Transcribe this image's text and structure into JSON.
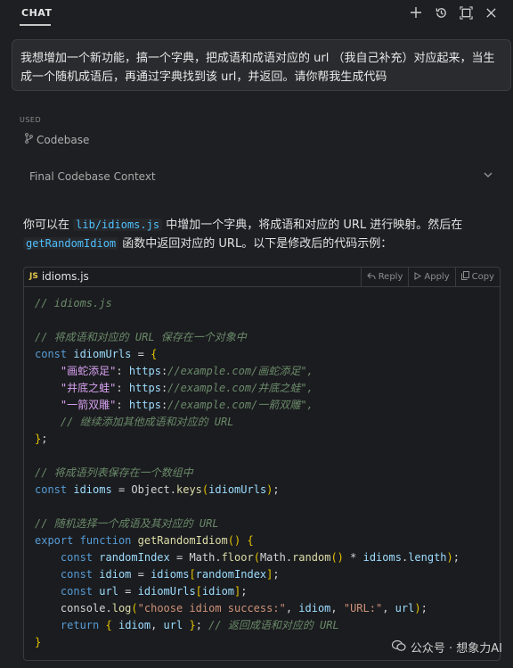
{
  "header": {
    "tab_label": "CHAT"
  },
  "header_icons": [
    "plus-icon",
    "history-icon",
    "maximize-icon",
    "close-icon"
  ],
  "user_message": "我想增加一个新功能，搞一个字典，把成语和成语对应的 url （我自己补充）对应起来，当生成一个随机成语后，再通过字典找到该 url，并返回。请你帮我生成代码",
  "context": {
    "used_label": "USED",
    "codebase_label": "Codebase",
    "final_label": "Final Codebase Context"
  },
  "answer": {
    "part1": "你可以在 ",
    "code1": "lib/idioms.js",
    "part2": " 中增加一个字典，将成语和对应的 URL 进行映射。然后在 ",
    "code2": "getRandomIdiom",
    "part3": " 函数中返回对应的 URL。以下是修改后的代码示例："
  },
  "code_block": {
    "filename": "idioms.js",
    "lang_badge": "JS",
    "actions": {
      "reply": "Reply",
      "apply": "Apply",
      "copy": "Copy"
    },
    "lines": [
      "// idioms.js",
      "",
      "// 将成语和对应的 URL 保存在一个对象中",
      "const idiomUrls = {",
      "    \"画蛇添足\": \"https://example.com/画蛇添足\",",
      "    \"井底之蛙\": \"https://example.com/井底之蛙\",",
      "    \"一箭双雕\": \"https://example.com/一箭双雕\",",
      "    // 继续添加其他成语和对应的 URL",
      "};",
      "",
      "// 将成语列表保存在一个数组中",
      "const idioms = Object.keys(idiomUrls);",
      "",
      "// 随机选择一个成语及其对应的 URL",
      "export function getRandomIdiom() {",
      "    const randomIndex = Math.floor(Math.random() * idioms.length);",
      "    const idiom = idioms[randomIndex];",
      "    const url = idiomUrls[idiom];",
      "    console.log(\"choose idiom success:\", idiom, \"URL:\", url);",
      "    return { idiom, url }; // 返回成语和对应的 URL",
      "}"
    ]
  },
  "watermark": "公众号 · 想象力AI",
  "colors": {
    "background": "#1e1f22",
    "keyword": "#569cd6",
    "string": "#ce9178",
    "comment": "#6a8a6a"
  }
}
